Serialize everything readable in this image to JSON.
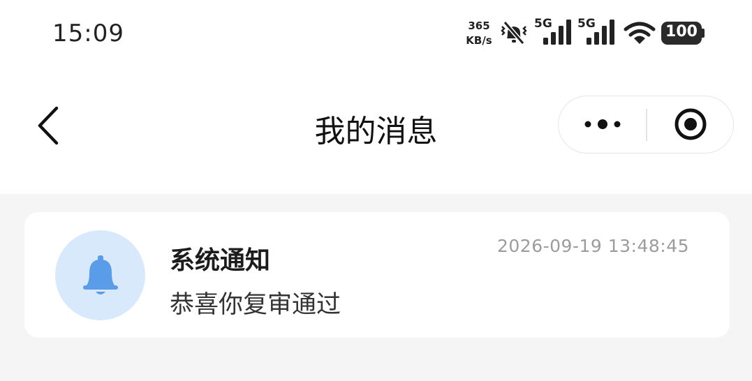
{
  "status_bar": {
    "time": "15:09",
    "net_speed_value": "365",
    "net_speed_unit": "KB/s",
    "sim1_label": "5G",
    "sim2_label": "5G",
    "battery": "100",
    "icons": [
      "mute-vibrate-icon",
      "signal-icon",
      "signal-icon",
      "wifi-icon",
      "battery-icon"
    ]
  },
  "nav": {
    "title": "我的消息",
    "back_icon": "chevron-left-icon",
    "more_icon": "more-dots-icon",
    "close_icon": "record-circle-icon"
  },
  "messages": [
    {
      "icon": "bell-icon",
      "title": "系统通知",
      "body": "恭喜你复审通过",
      "time": "2026-09-19 13:48:45"
    }
  ],
  "colors": {
    "page_background": "#f5f5f5",
    "avatar_background": "#d9e9fc",
    "bell_color": "#5b9ce8",
    "timestamp_color": "#9c9c9c"
  }
}
